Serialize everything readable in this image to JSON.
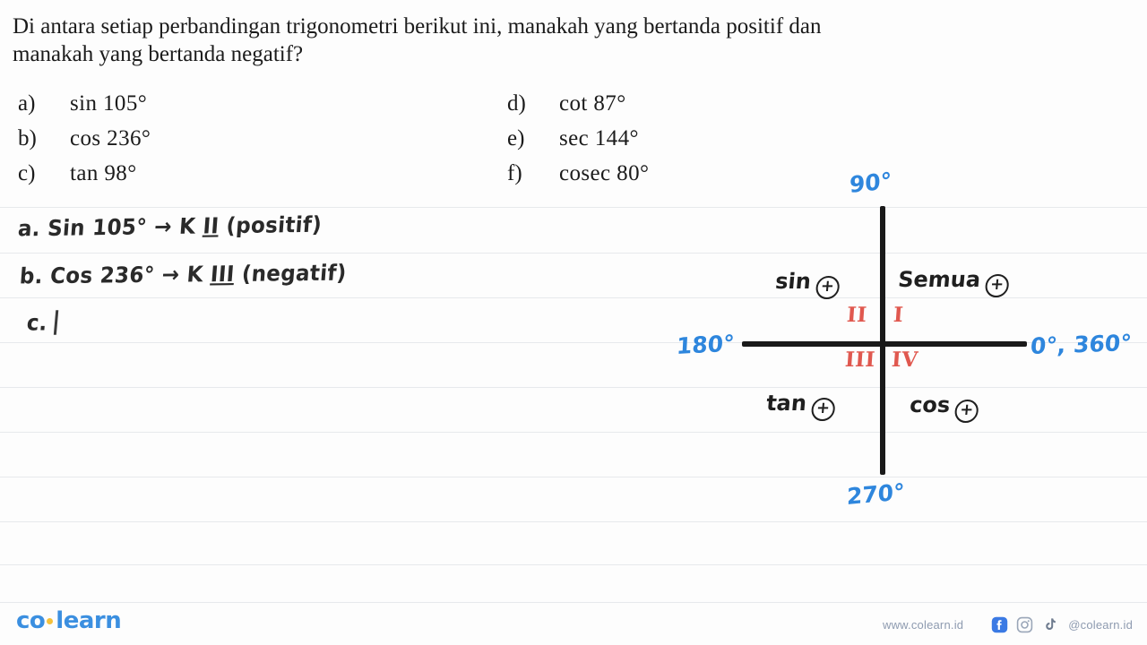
{
  "question": {
    "prompt_line1": "Di antara setiap perbandingan trigonometri berikut ini, manakah yang bertanda positif dan",
    "prompt_line2": "manakah yang bertanda negatif?",
    "options_left": [
      {
        "letter": "a)",
        "text": "sin 105°"
      },
      {
        "letter": "b)",
        "text": "cos 236°"
      },
      {
        "letter": "c)",
        "text": "tan 98°"
      }
    ],
    "options_right": [
      {
        "letter": "d)",
        "text": "cot 87°"
      },
      {
        "letter": "e)",
        "text": "sec 144°"
      },
      {
        "letter": "f)",
        "text": "cosec 80°"
      }
    ]
  },
  "handwritten_answers": {
    "a_prefix": "a. Sin 105° → K ",
    "a_roman": "II",
    "a_suffix": " (positif)",
    "b_prefix": "b. Cos 236° → K ",
    "b_roman": "III",
    "b_suffix": " (negatif)",
    "c_prefix": "c."
  },
  "diagram": {
    "axis_labels": {
      "top": "90°",
      "left": "180°",
      "right": "0°, 360°",
      "bottom": "270°"
    },
    "quadrant_signs": {
      "q1_text": "Semua",
      "q1_sign": "+",
      "q2_text": "sin",
      "q2_sign": "+",
      "q3_text": "tan",
      "q3_sign": "+",
      "q4_text": "cos",
      "q4_sign": "+"
    },
    "quadrant_numerals": {
      "q1": "I",
      "q2": "II",
      "q3": "III",
      "q4": "IV"
    },
    "colors": {
      "axis": "#1a1a1a",
      "degree_label": "#2e86dd",
      "numeral": "#e0584f",
      "handwriting": "#1f1f1f"
    }
  },
  "footer": {
    "logo_co": "co",
    "logo_learn": "learn",
    "website": "www.colearn.id",
    "handle": "@colearn.id",
    "social": [
      "facebook-icon",
      "instagram-icon",
      "tiktok-icon"
    ],
    "logo_color": "#3b8fe0",
    "logo_dot_color": "#f5c13b"
  },
  "paper": {
    "background": "#fdfdfd",
    "rule_color": "#e7e9ec",
    "rule_positions": [
      231,
      282,
      332,
      382,
      432,
      482,
      532,
      582,
      630,
      672
    ]
  }
}
